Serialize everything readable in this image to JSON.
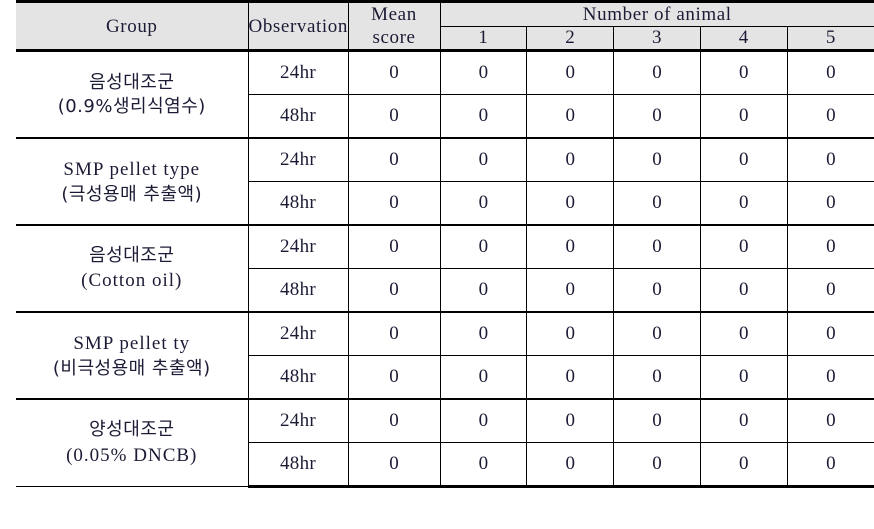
{
  "table": {
    "headers": {
      "group": "Group",
      "observation": "Observation",
      "mean_score_line1": "Mean",
      "mean_score_line2": "score",
      "number_of_animal": "Number of animal",
      "animals": [
        "1",
        "2",
        "3",
        "4",
        "5"
      ]
    },
    "groups": [
      {
        "name_line1": "음성대조군",
        "name_line2": "(0.9%생리식염수)",
        "name_line1_lang": "ko",
        "name_line2_lang": "ko",
        "rows": [
          {
            "observation": "24hr",
            "mean_score": "0",
            "animals": [
              "0",
              "0",
              "0",
              "0",
              "0"
            ]
          },
          {
            "observation": "48hr",
            "mean_score": "0",
            "animals": [
              "0",
              "0",
              "0",
              "0",
              "0"
            ]
          }
        ]
      },
      {
        "name_line1": "SMP pellet type",
        "name_line2": "(극성용매 추출액)",
        "name_line1_lang": "en",
        "name_line2_lang": "ko",
        "rows": [
          {
            "observation": "24hr",
            "mean_score": "0",
            "animals": [
              "0",
              "0",
              "0",
              "0",
              "0"
            ]
          },
          {
            "observation": "48hr",
            "mean_score": "0",
            "animals": [
              "0",
              "0",
              "0",
              "0",
              "0"
            ]
          }
        ]
      },
      {
        "name_line1": "음성대조군",
        "name_line2": "(Cotton oil)",
        "name_line1_lang": "ko",
        "name_line2_lang": "en",
        "rows": [
          {
            "observation": "24hr",
            "mean_score": "0",
            "animals": [
              "0",
              "0",
              "0",
              "0",
              "0"
            ]
          },
          {
            "observation": "48hr",
            "mean_score": "0",
            "animals": [
              "0",
              "0",
              "0",
              "0",
              "0"
            ]
          }
        ]
      },
      {
        "name_line1": "SMP pellet ty",
        "name_line2": "(비극성용매 추출액)",
        "name_line1_lang": "en",
        "name_line2_lang": "ko",
        "rows": [
          {
            "observation": "24hr",
            "mean_score": "0",
            "animals": [
              "0",
              "0",
              "0",
              "0",
              "0"
            ]
          },
          {
            "observation": "48hr",
            "mean_score": "0",
            "animals": [
              "0",
              "0",
              "0",
              "0",
              "0"
            ]
          }
        ]
      },
      {
        "name_line1": "양성대조군",
        "name_line2": "(0.05% DNCB)",
        "name_line1_lang": "ko",
        "name_line2_lang": "en",
        "rows": [
          {
            "observation": "24hr",
            "mean_score": "0",
            "animals": [
              "0",
              "0",
              "0",
              "0",
              "0"
            ]
          },
          {
            "observation": "48hr",
            "mean_score": "0",
            "animals": [
              "0",
              "0",
              "0",
              "0",
              "0"
            ]
          }
        ]
      }
    ]
  },
  "colors": {
    "header_background": "#e4e4e4",
    "border": "#000000",
    "text": "#1b1b35",
    "page_background": "#ffffff"
  }
}
